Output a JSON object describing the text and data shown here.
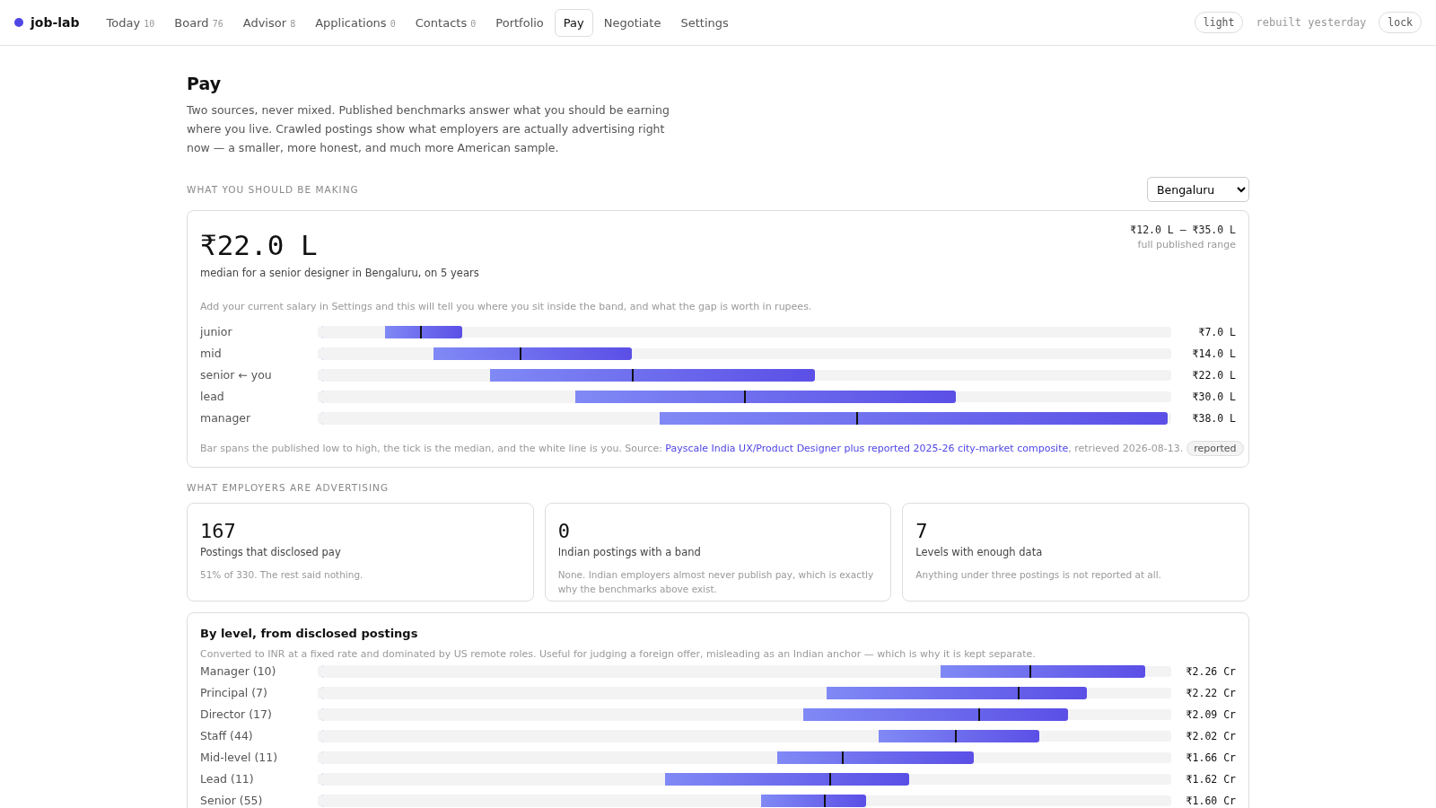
{
  "nav": {
    "brand": "job-lab",
    "tabs": [
      {
        "label": "Today",
        "count": "10",
        "selected": false
      },
      {
        "label": "Board",
        "count": "76",
        "selected": false
      },
      {
        "label": "Advisor",
        "count": "8",
        "selected": false
      },
      {
        "label": "Applications",
        "count": "0",
        "selected": false
      },
      {
        "label": "Contacts",
        "count": "0",
        "selected": false
      },
      {
        "label": "Portfolio",
        "selected": false
      },
      {
        "label": "Pay",
        "selected": true
      },
      {
        "label": "Negotiate",
        "selected": false
      },
      {
        "label": "Settings",
        "selected": false
      }
    ],
    "theme_button": "light",
    "status": "rebuilt yesterday",
    "lock_button": "lock"
  },
  "page": {
    "title": "Pay",
    "intro": "Two sources, never mixed. Published benchmarks answer what you should be earning where you live. Crawled postings show what employers are actually advertising right now — a smaller, more honest, and much more American sample."
  },
  "benchmarks": {
    "heading": "WHAT YOU SHOULD BE MAKING",
    "city": "Bengaluru",
    "median": "₹22.0 L",
    "caption": "median for a senior designer in Bengaluru, on 5 years",
    "range": "₹12.0 L – ₹35.0 L",
    "range_label": "full published range",
    "hint": "Add your current salary in Settings and this will tell you where you sit inside the band, and what the gap is worth in rupees.",
    "rows": [
      {
        "label": "junior",
        "value": "₹7.0 L",
        "low": {
          "level": 0.075
        },
        "median": {
          "level": 0.118
        },
        "high": {
          "level": 0.167
        }
      },
      {
        "label": "mid",
        "value": "₹14.0 L",
        "low": {
          "level": 0.133
        },
        "median": {
          "level": 0.235
        },
        "high": {
          "level": 0.367
        }
      },
      {
        "label": "senior ← you",
        "value": "₹22.0 L",
        "low": {
          "level": 0.199
        },
        "median": {
          "level": 0.368
        },
        "high": {
          "level": 0.583
        }
      },
      {
        "label": "lead",
        "value": "₹30.0 L",
        "low": {
          "level": 0.3
        },
        "median": {
          "level": 0.501
        },
        "high": {
          "level": 0.75
        }
      },
      {
        "label": "manager",
        "value": "₹38.0 L",
        "low": {
          "level": 0.4
        },
        "median": {
          "level": 0.633
        },
        "high": {
          "level": 1.0
        }
      }
    ],
    "note": {
      "before": "Bar spans the published low to high, the tick is the median, and the white line is you. Source: ",
      "link": "Payscale India UX/Product Designer plus reported 2025-26 city-market composite",
      "after": ", retrieved 2026-08-13.",
      "badge": "reported"
    }
  },
  "advertising": {
    "heading": "WHAT EMPLOYERS ARE ADVERTISING",
    "stats": [
      {
        "number": "167",
        "label": "Postings that disclosed pay",
        "detail": "51% of 330. The rest said nothing."
      },
      {
        "number": "0",
        "label": "Indian postings with a band",
        "detail": "None. Indian employers almost never publish pay, which is exactly why the benchmarks above exist."
      },
      {
        "number": "7",
        "label": "Levels with enough data",
        "detail": "Anything under three postings is not reported at all."
      }
    ],
    "levels": {
      "title": "By level, from disclosed postings",
      "hint": "Converted to INR at a fixed rate and dominated by US remote roles. Useful for judging a foreign offer, misleading as an Indian anchor — which is why it is kept separate.",
      "rows": [
        {
          "label": "Manager (10)",
          "value": "₹2.26 Cr",
          "low": {
            "level": 0.732
          },
          "median": {
            "level": 0.838
          },
          "high": {
            "level": 0.974
          }
        },
        {
          "label": "Principal (7)",
          "value": "₹2.22 Cr",
          "low": {
            "level": 0.597
          },
          "median": {
            "level": 0.824
          },
          "high": {
            "level": 0.905
          }
        },
        {
          "label": "Director (17)",
          "value": "₹2.09 Cr",
          "low": {
            "level": 0.569
          },
          "median": {
            "level": 0.777
          },
          "high": {
            "level": 0.882
          }
        },
        {
          "label": "Staff (44)",
          "value": "₹2.02 Cr",
          "low": {
            "level": 0.659
          },
          "median": {
            "level": 0.75
          },
          "high": {
            "level": 0.848
          }
        },
        {
          "label": "Mid-level (11)",
          "value": "₹1.66 Cr",
          "low": {
            "level": 0.539
          },
          "median": {
            "level": 0.616
          },
          "high": {
            "level": 0.771
          }
        },
        {
          "label": "Lead (11)",
          "value": "₹1.62 Cr",
          "low": {
            "level": 0.406
          },
          "median": {
            "level": 0.601
          },
          "high": {
            "level": 0.695
          }
        },
        {
          "label": "Senior (55)",
          "value": "₹1.60 Cr",
          "low": {
            "level": 0.52
          },
          "median": {
            "level": 0.595
          },
          "high": {
            "level": 0.644
          }
        }
      ]
    }
  }
}
